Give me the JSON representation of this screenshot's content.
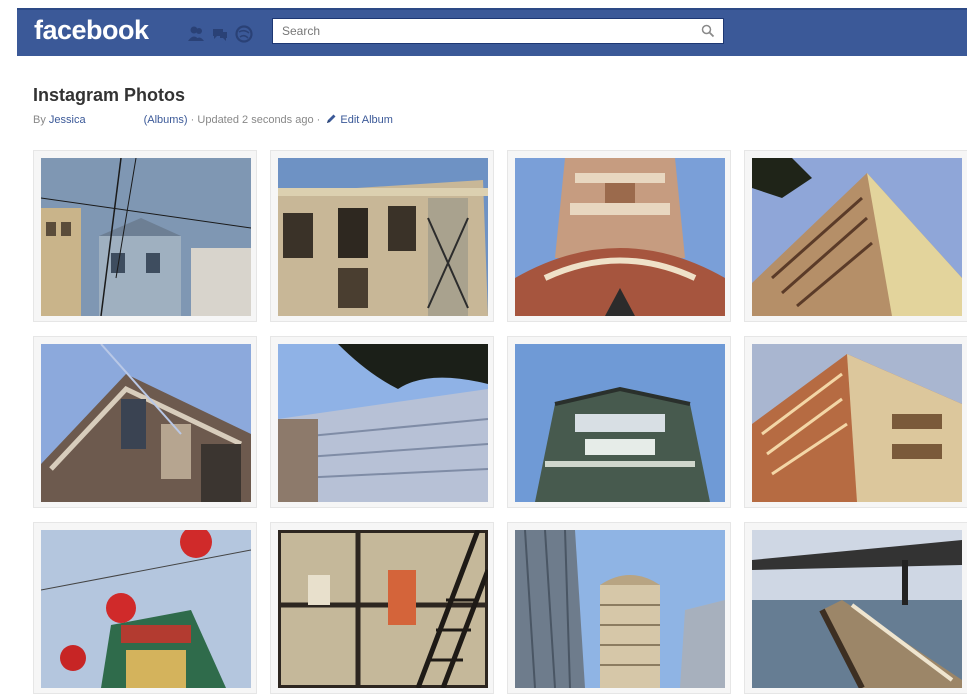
{
  "header": {
    "logo": "facebook",
    "search_placeholder": "Search",
    "icons": [
      "friend-requests-icon",
      "messages-icon",
      "notifications-icon",
      "search-icon"
    ],
    "brand_color": "#3b5998"
  },
  "album": {
    "title": "Instagram Photos",
    "by_prefix": "By",
    "author": "Jessica",
    "category": "(Albums)",
    "updated": " · Updated 2 seconds ago · ",
    "edit_label": "Edit Album"
  },
  "photos": [
    {
      "subject": "victorian houses with power lines"
    },
    {
      "subject": "apartment building with fire escape"
    },
    {
      "subject": "round tower from below"
    },
    {
      "subject": "corner building with bay windows"
    },
    {
      "subject": "pitched roof bay window"
    },
    {
      "subject": "glass tower with tree"
    },
    {
      "subject": "building corner with balconies"
    },
    {
      "subject": "building with fire escapes"
    },
    {
      "subject": "chinatown gate with red lanterns"
    },
    {
      "subject": "window with ladder"
    },
    {
      "subject": "high-rise towers"
    },
    {
      "subject": "pier over water"
    }
  ]
}
